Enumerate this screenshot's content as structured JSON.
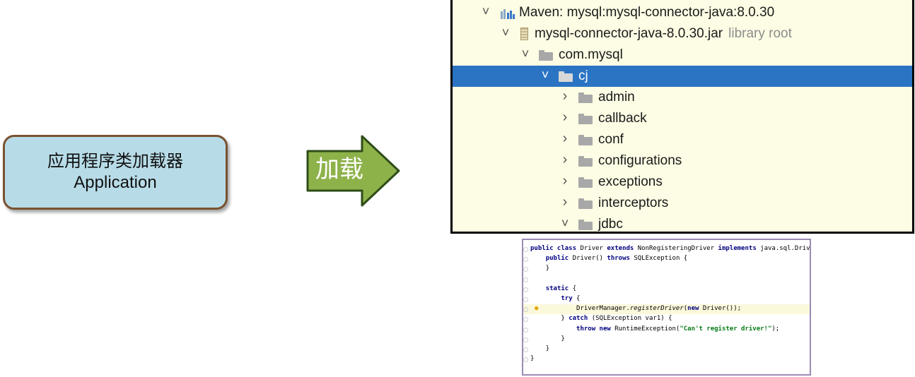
{
  "loader": {
    "line1": "应用程序类加载器",
    "line2": "Application"
  },
  "arrow": {
    "label": "加载",
    "fill": "#8db24a",
    "stroke": "#2e4d18"
  },
  "tree": {
    "selected_color": "#2b74c4",
    "rows": [
      {
        "label": "Maven: mysql:mysql-connector-java:8.0.30",
        "hint": "",
        "chevron": "down",
        "icon": "maven-library-icon"
      },
      {
        "label": "mysql-connector-java-8.0.30.jar",
        "hint": "library root",
        "chevron": "down",
        "icon": "jar-icon"
      },
      {
        "label": "com.mysql",
        "hint": "",
        "chevron": "down",
        "icon": "folder-icon"
      },
      {
        "label": "cj",
        "hint": "",
        "chevron": "down",
        "icon": "folder-icon",
        "selected": true
      },
      {
        "label": "admin",
        "hint": "",
        "chevron": "right",
        "icon": "folder-icon"
      },
      {
        "label": "callback",
        "hint": "",
        "chevron": "right",
        "icon": "folder-icon"
      },
      {
        "label": "conf",
        "hint": "",
        "chevron": "right",
        "icon": "folder-icon"
      },
      {
        "label": "configurations",
        "hint": "",
        "chevron": "right",
        "icon": "folder-icon"
      },
      {
        "label": "exceptions",
        "hint": "",
        "chevron": "right",
        "icon": "folder-icon"
      },
      {
        "label": "interceptors",
        "hint": "",
        "chevron": "right",
        "icon": "folder-icon"
      },
      {
        "label": "jdbc",
        "hint": "",
        "chevron": "down",
        "icon": "folder-icon"
      }
    ]
  },
  "code": {
    "lines": [
      [
        [
          "kw",
          "public class "
        ],
        [
          "",
          "Driver "
        ],
        [
          "kw",
          "extends "
        ],
        [
          "",
          "NonRegisteringDriver "
        ],
        [
          "kw",
          "implements "
        ],
        [
          "",
          "java.sql.Driver {"
        ]
      ],
      [
        [
          "",
          "    "
        ],
        [
          "kw",
          "public "
        ],
        [
          "",
          "Driver() "
        ],
        [
          "kw",
          "throws "
        ],
        [
          "",
          "SQLException {"
        ]
      ],
      [
        [
          "",
          "    }"
        ]
      ],
      [
        [
          "",
          ""
        ]
      ],
      [
        [
          "",
          "    "
        ],
        [
          "kw",
          "static "
        ],
        [
          "",
          "{"
        ]
      ],
      [
        [
          "",
          "        "
        ],
        [
          "kw",
          "try "
        ],
        [
          "",
          "{"
        ]
      ],
      [
        [
          "",
          "            DriverManager."
        ],
        [
          "it",
          "registerDriver"
        ],
        [
          "",
          "("
        ],
        [
          "kw",
          "new "
        ],
        [
          "",
          "Driver());"
        ]
      ],
      [
        [
          "",
          "        } "
        ],
        [
          "kw",
          "catch "
        ],
        [
          "",
          "(SQLException var1) {"
        ]
      ],
      [
        [
          "",
          "            "
        ],
        [
          "kw",
          "throw new "
        ],
        [
          "",
          "RuntimeException("
        ],
        [
          "str",
          "\"Can't register driver!\""
        ],
        [
          "",
          ");"
        ]
      ],
      [
        [
          "",
          "        }"
        ]
      ],
      [
        [
          "",
          "    }"
        ]
      ],
      [
        [
          "",
          "}"
        ]
      ]
    ],
    "highlight_line": 6
  }
}
